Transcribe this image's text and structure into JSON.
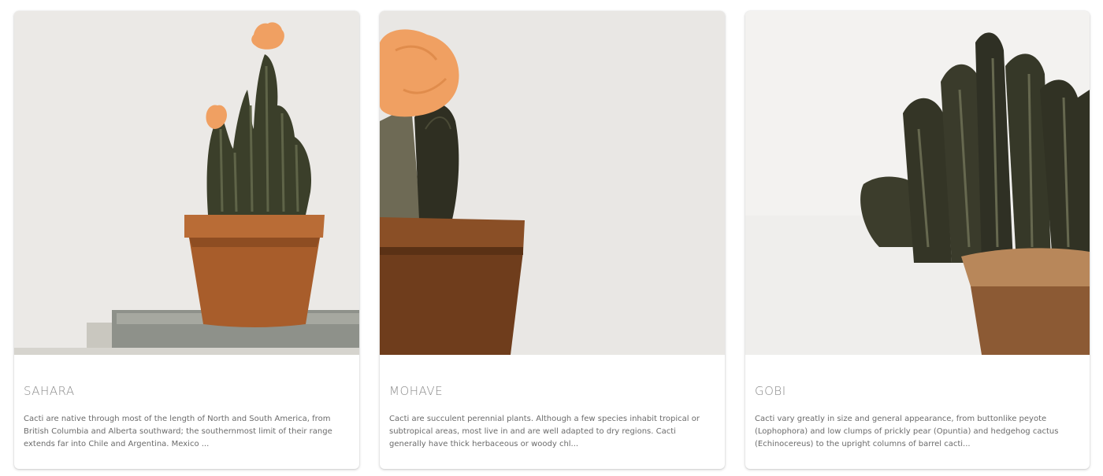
{
  "cards": [
    {
      "title": "SAHARA",
      "text": "Cacti are native through most of the length of North and South America, from British Columbia and Alberta southward; the southernmost limit of their range extends far into Chile and Argentina. Mexico ...",
      "image": "potted-cactus-on-books-photo"
    },
    {
      "title": "MOHAVE",
      "text": "Cacti are succulent perennial plants. Although a few species inhabit tropical or subtropical areas, most live in and are well adapted to dry regions. Cacti generally have thick herbaceous or woody chl...",
      "image": "grafted-moon-cactus-photo"
    },
    {
      "title": "GOBI",
      "text": "Cacti vary greatly in size and general appearance, from buttonlike peyote (Lophophora) and low clumps of prickly pear (Opuntia) and hedgehog cactus (Echinocereus) to the upright columns of barrel cacti...",
      "image": "barrel-cactus-closeup-photo"
    }
  ],
  "colors": {
    "terracotta": "#b96c36",
    "cactus_green": "#3b3f2a",
    "flower_orange": "#f0a062",
    "background_wall": "#ebe9e6"
  }
}
